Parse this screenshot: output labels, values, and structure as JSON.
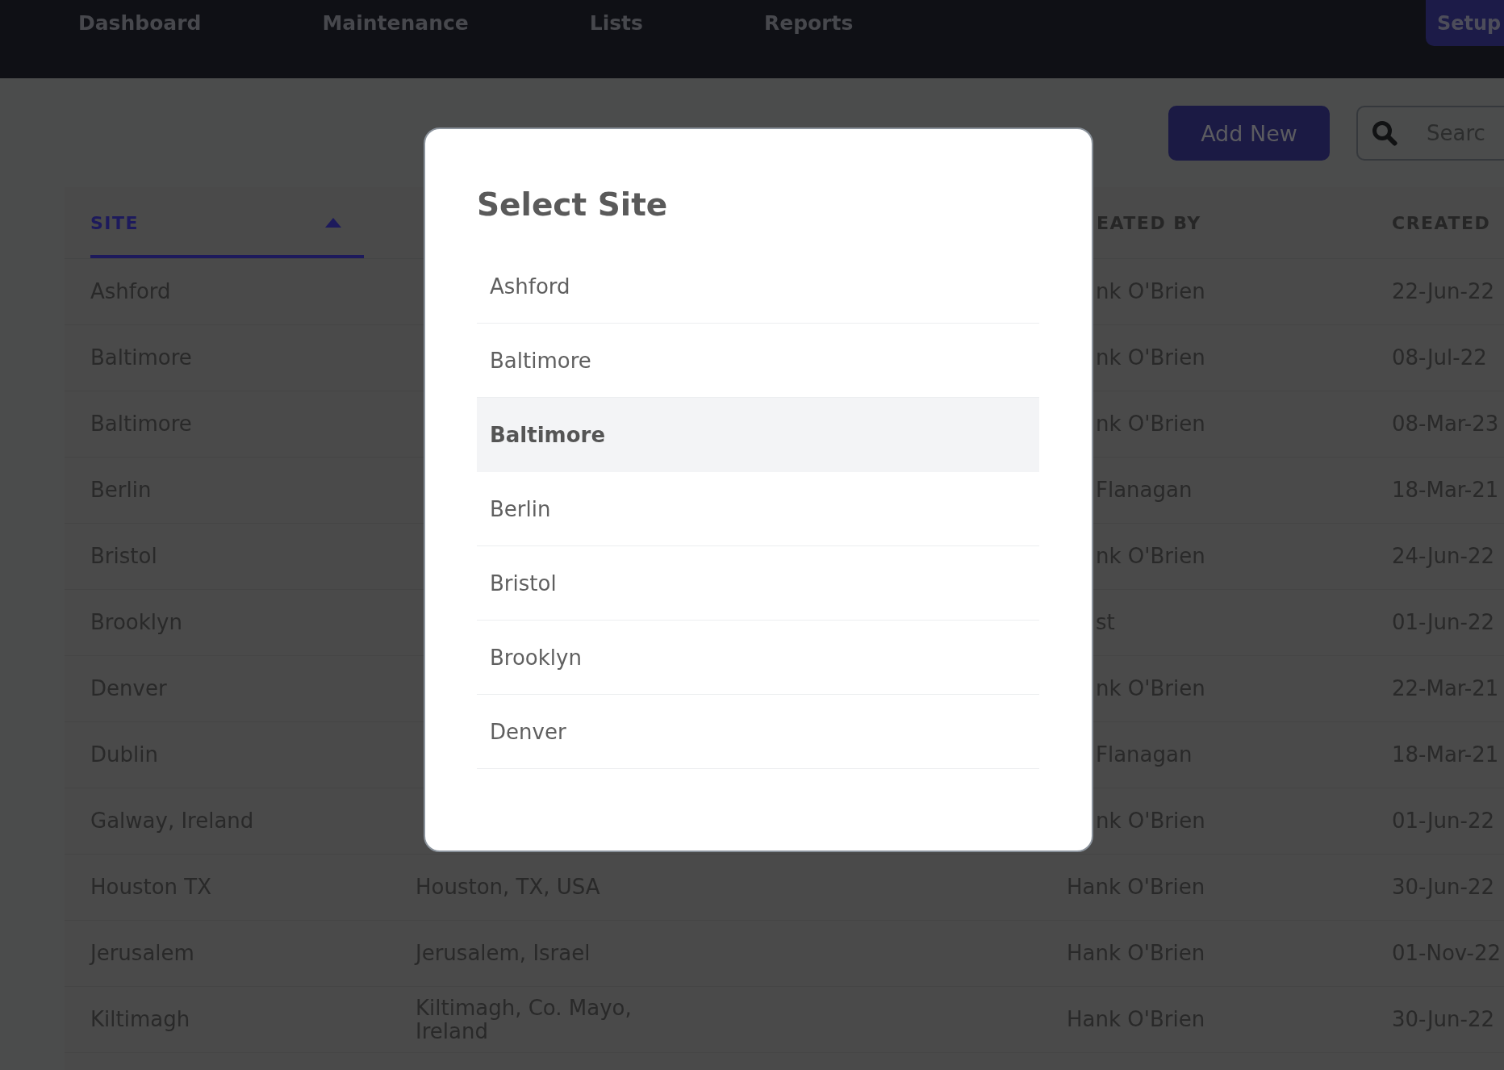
{
  "nav": {
    "items": [
      "Dashboard",
      "Maintenance",
      "Lists",
      "Reports"
    ],
    "setup_button": "Setup"
  },
  "toolbar": {
    "add_button": "Add New",
    "search": {
      "placeholder": "Searc"
    }
  },
  "table": {
    "header": {
      "site": {
        "label": "SITE",
        "selected": true,
        "ascending": true
      },
      "column_3": {
        "label": "EATED BY",
        "selected": false
      },
      "created": {
        "label": "CREATED",
        "selected": false
      }
    },
    "rows": [
      {
        "site": "Ashford",
        "column_3": "nk O'Brien",
        "created": "22-Jun-22"
      },
      {
        "site": "Baltimore",
        "column_3": "nk O'Brien",
        "created": "08-Jul-22"
      },
      {
        "site": "Baltimore",
        "column_3": "nk O'Brien",
        "created": "08-Mar-23"
      },
      {
        "site": "Berlin",
        "column_3": "Flanagan",
        "created": "18-Mar-21"
      },
      {
        "site": "Bristol",
        "column_3": "nk O'Brien",
        "created": "24-Jun-22"
      },
      {
        "site": "Brooklyn",
        "column_3": "st",
        "created": "01-Jun-22"
      },
      {
        "site": "Denver",
        "column_3": "nk O'Brien",
        "created": "22-Mar-21"
      },
      {
        "site": "Dublin",
        "column_3": "Flanagan",
        "created": "18-Mar-21"
      },
      {
        "site": "Galway, Ireland",
        "column_3": "nk O'Brien",
        "created": "01-Jun-22"
      },
      {
        "site": "Houston TX",
        "column_2": "Houston, TX, USA",
        "column_3": "Hank O'Brien",
        "created": "30-Jun-22"
      },
      {
        "site": "Jerusalem",
        "column_2": "Jerusalem, Israel",
        "column_3": "Hank O'Brien",
        "created": "01-Nov-22"
      },
      {
        "site": "Kiltimagh",
        "column_2": "Kiltimagh, Co. Mayo, Ireland",
        "column_3": "Hank O'Brien",
        "created": "30-Jun-22"
      }
    ]
  },
  "modal": {
    "title": "Select Site",
    "items": [
      {
        "label": "Ashford",
        "selected": false
      },
      {
        "label": "Baltimore",
        "selected": false
      },
      {
        "label": "Baltimore",
        "selected": true
      },
      {
        "label": "Berlin",
        "selected": false
      },
      {
        "label": "Bristol",
        "selected": false
      },
      {
        "label": "Brooklyn",
        "selected": false
      },
      {
        "label": "Denver",
        "selected": false
      }
    ]
  }
}
